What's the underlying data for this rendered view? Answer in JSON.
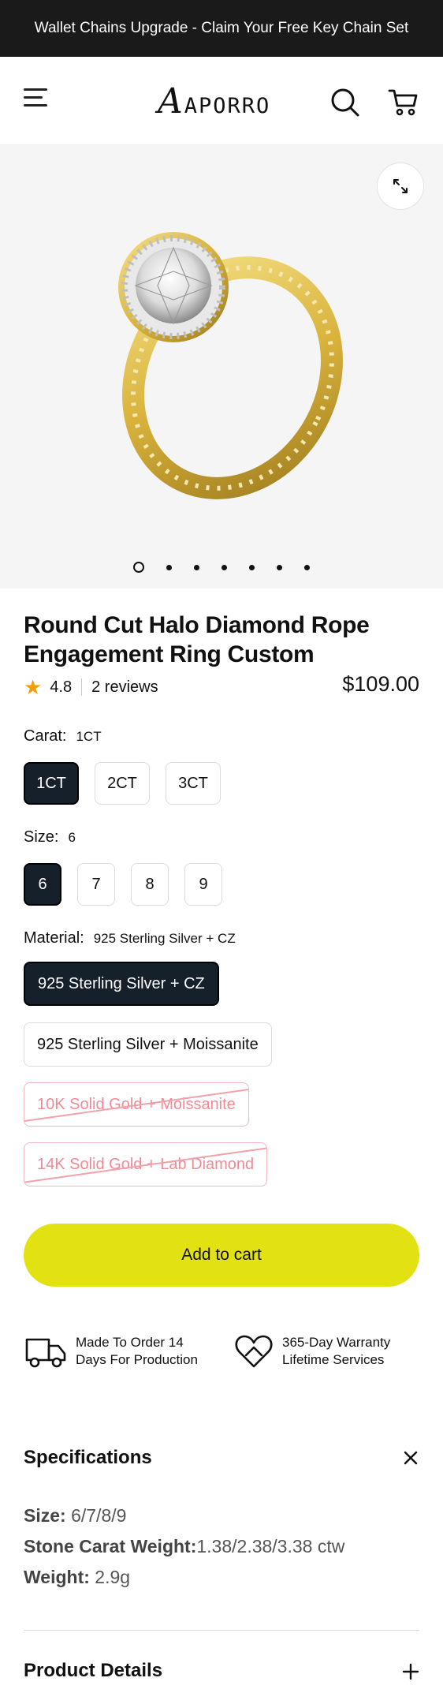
{
  "announcement": "Wallet Chains Upgrade - Claim Your Free Key Chain Set",
  "brand": {
    "mark": "A",
    "name": "APORRO"
  },
  "gallery": {
    "total_images": 7,
    "active_index": 0
  },
  "product": {
    "title": "Round Cut Halo Diamond Rope Engagement Ring Custom",
    "rating": "4.8",
    "reviews": "2 reviews",
    "price": "$109.00"
  },
  "carat": {
    "label": "Carat:",
    "selected": "1CT",
    "options": [
      "1CT",
      "2CT",
      "3CT"
    ]
  },
  "size": {
    "label": "Size:",
    "selected": "6",
    "options": [
      "6",
      "7",
      "8",
      "9"
    ]
  },
  "material": {
    "label": "Material:",
    "selected": "925 Sterling Silver + CZ",
    "options": [
      {
        "label": "925 Sterling Silver + CZ",
        "state": "selected"
      },
      {
        "label": "925 Sterling Silver + Moissanite",
        "state": "available"
      },
      {
        "label": "10K Solid Gold + Moissanite",
        "state": "unavailable"
      },
      {
        "label": "14K Solid Gold + Lab Diamond",
        "state": "unavailable"
      }
    ]
  },
  "add_to_cart": "Add to cart",
  "features": [
    {
      "icon": "truck-icon",
      "line1": "Made To Order 14",
      "line2": "Days For Production"
    },
    {
      "icon": "heart-hands-icon",
      "line1": "365-Day Warranty",
      "line2": "Lifetime Services"
    }
  ],
  "specifications": {
    "title": "Specifications",
    "items": [
      {
        "key": "Size:",
        "value": " 6/7/8/9"
      },
      {
        "key": "Stone Carat Weight:",
        "value": "1.38/2.38/3.38 ctw"
      },
      {
        "key": "Weight:",
        "value": " 2.9g"
      }
    ]
  },
  "product_details": {
    "title": "Product Details"
  },
  "colors": {
    "announcement_bg": "#1a1a1a",
    "selected_chip": "#15202b",
    "cta": "#e2e213",
    "star": "#f29f05",
    "unavailable": "#ef8b95"
  }
}
